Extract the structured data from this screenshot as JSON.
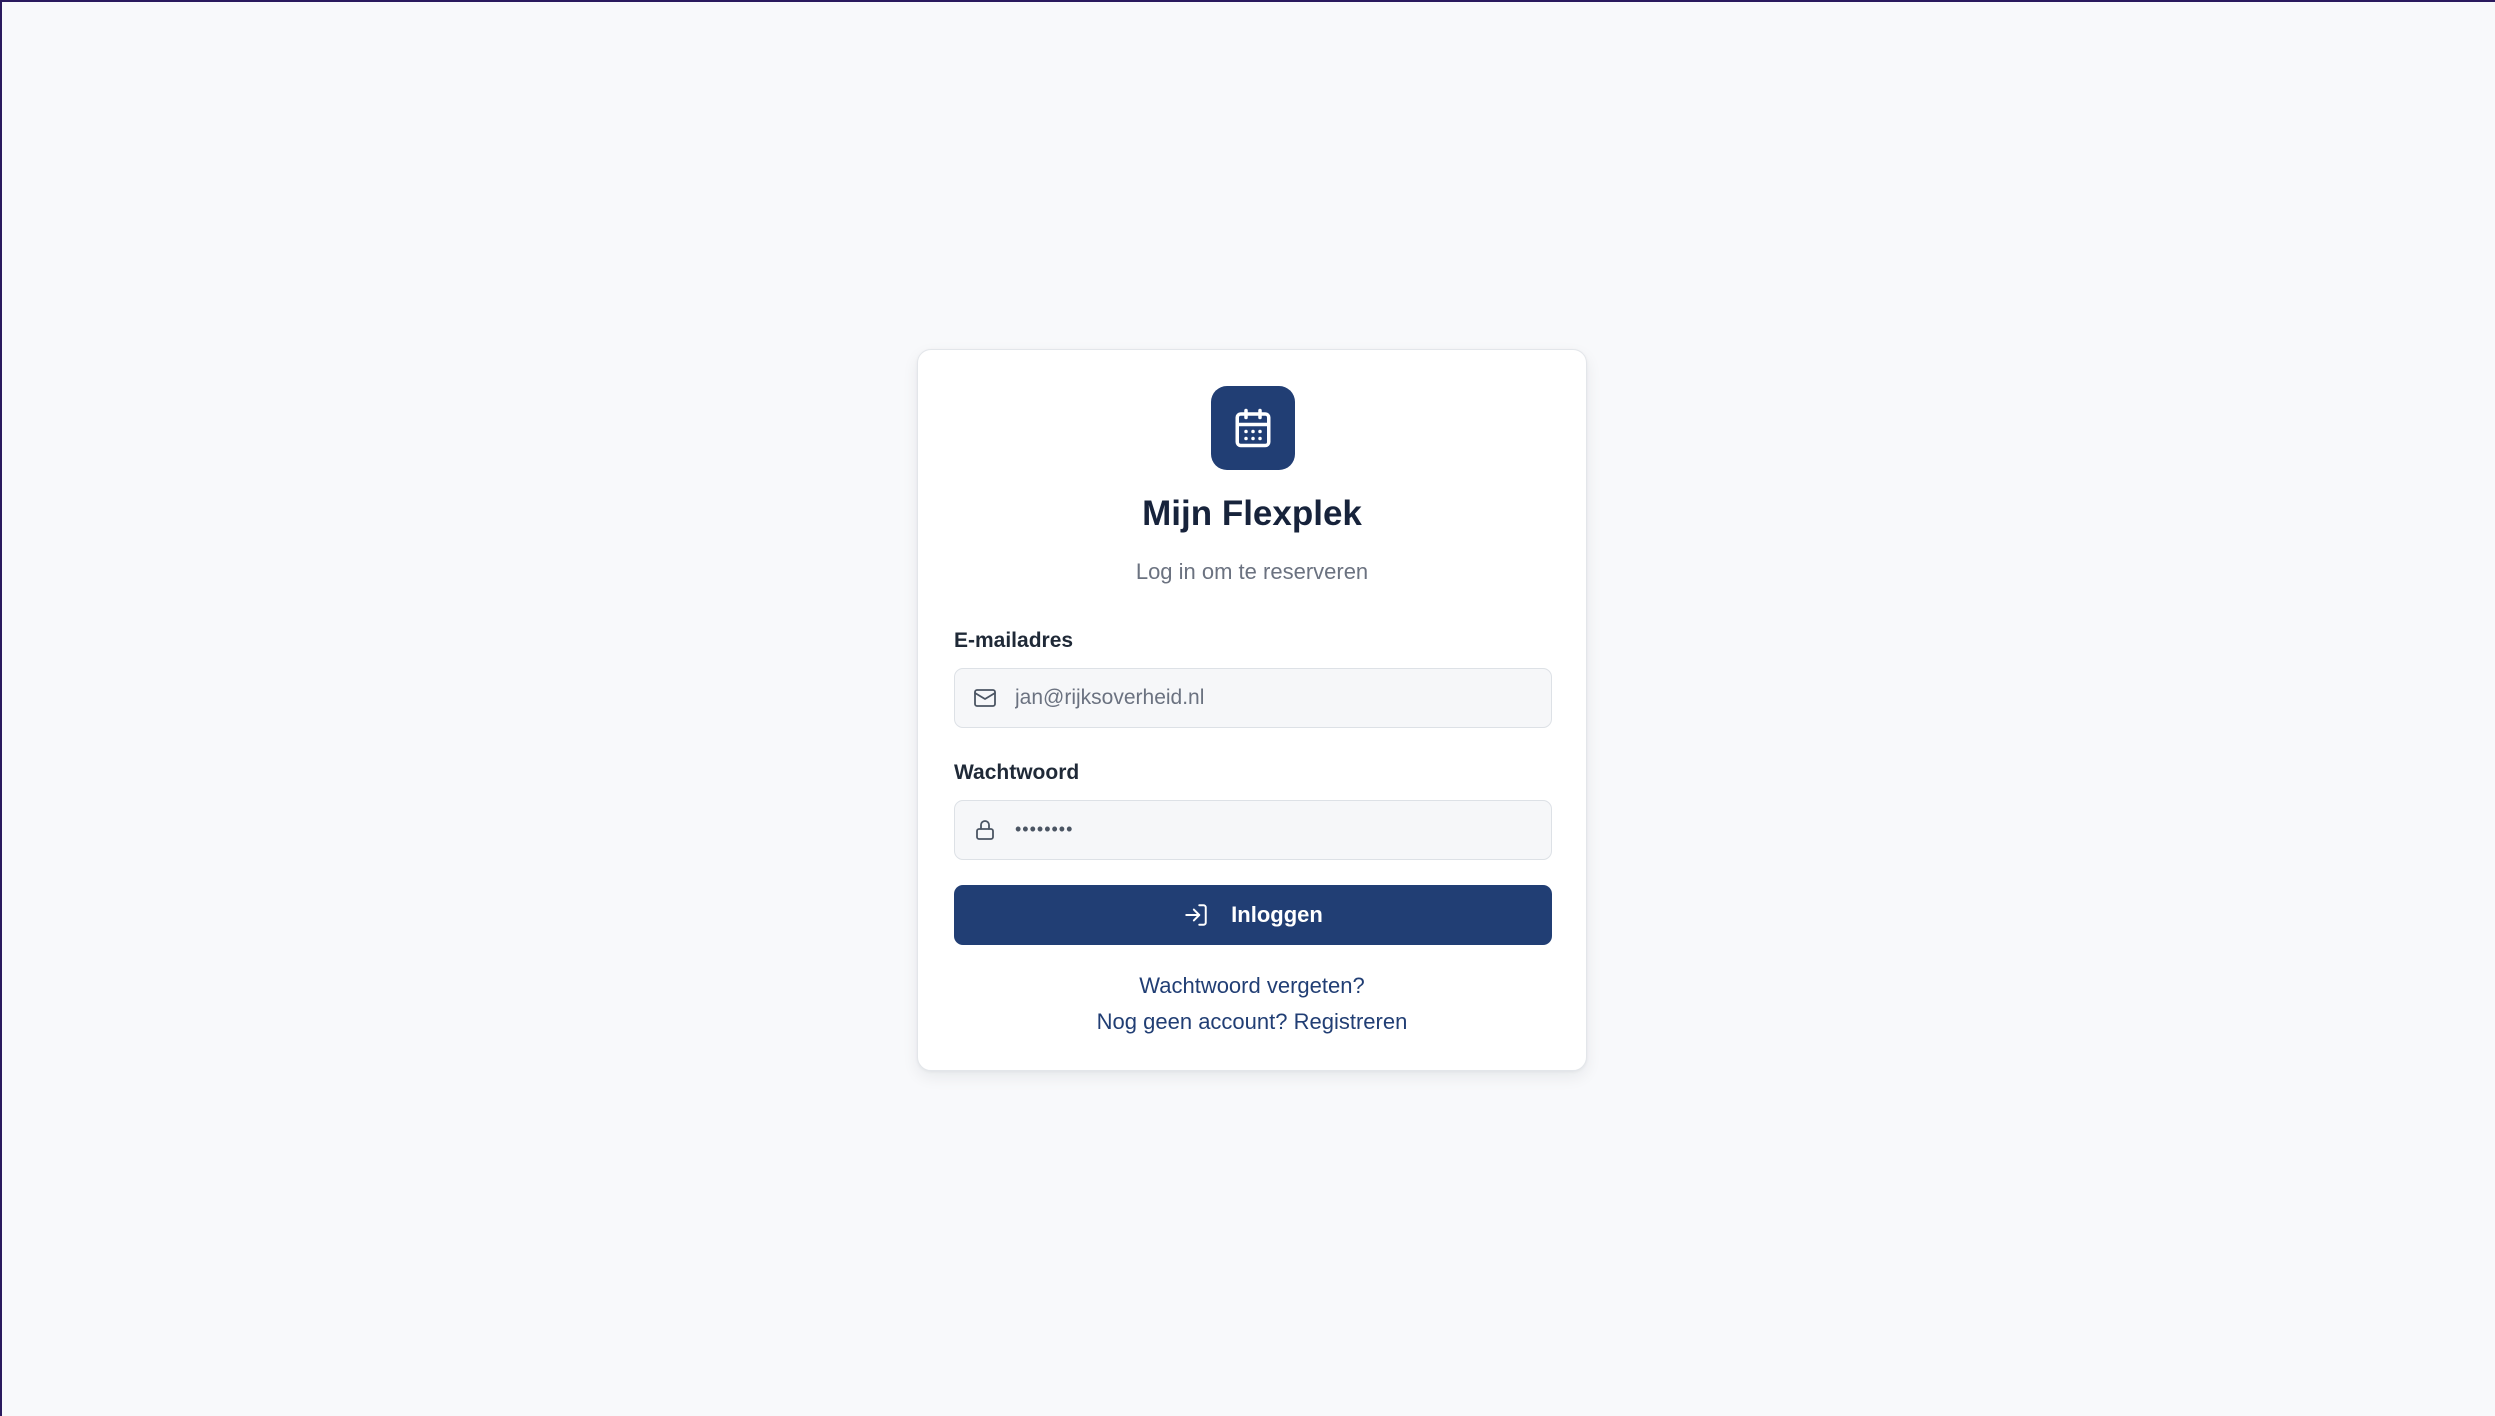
{
  "app": {
    "title": "Mijn Flexplek",
    "subtitle": "Log in om te reserveren",
    "logo_icon": "calendar-icon",
    "accent_color": "#213e74"
  },
  "form": {
    "email": {
      "label": "E-mailadres",
      "placeholder": "jan@rijksoverheid.nl",
      "icon": "mail-icon"
    },
    "password": {
      "label": "Wachtwoord",
      "value": "••••••••",
      "icon": "lock-icon"
    },
    "submit": {
      "label": "Inloggen",
      "icon": "log-in-icon"
    }
  },
  "links": {
    "forgot_password": "Wachtwoord vergeten?",
    "register": "Nog geen account? Registreren"
  }
}
